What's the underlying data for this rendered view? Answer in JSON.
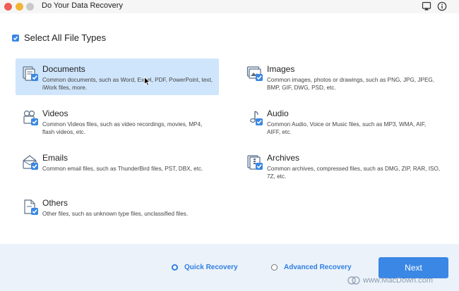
{
  "window": {
    "title": "Do Your Data Recovery"
  },
  "select_all": {
    "label": "Select All File Types",
    "checked": true
  },
  "file_types": [
    {
      "title": "Documents",
      "description": "Common documents, such as Word, Excel, PDF, PowerPoint, text, iWork files, more.",
      "icon": "documents-icon",
      "selected": true
    },
    {
      "title": "Images",
      "description": "Common images, photos or drawings, such as PNG, JPG, JPEG, BMP, GIF, DWG, PSD, etc.",
      "icon": "images-icon",
      "selected": false
    },
    {
      "title": "Videos",
      "description": "Common Videos files, such as video recordings, movies, MP4, flash videos, etc.",
      "icon": "videos-icon",
      "selected": false
    },
    {
      "title": "Audio",
      "description": "Common Audio, Voice or Music files, such as MP3, WMA, AIF, AIFF, etc.",
      "icon": "audio-icon",
      "selected": false
    },
    {
      "title": "Emails",
      "description": "Common email files, such as ThunderBird files, PST, DBX, etc.",
      "icon": "emails-icon",
      "selected": false
    },
    {
      "title": "Archives",
      "description": "Common archives, compressed files, such as DMG, ZIP, RAR, ISO, 7Z, etc.",
      "icon": "archives-icon",
      "selected": false
    },
    {
      "title": "Others",
      "description": "Other files, such as unknown type files, unclassified files.",
      "icon": "others-icon",
      "selected": false
    }
  ],
  "recovery_modes": {
    "quick": {
      "label": "Quick Recovery",
      "selected": true
    },
    "advanced": {
      "label": "Advanced Recovery",
      "selected": false
    }
  },
  "next_button": {
    "label": "Next"
  },
  "watermark": {
    "text": "www.MacDown.com"
  },
  "colors": {
    "accent": "#3a87e5",
    "selected_card": "#cfe5fb",
    "footer_bg": "#ebf2fa"
  }
}
